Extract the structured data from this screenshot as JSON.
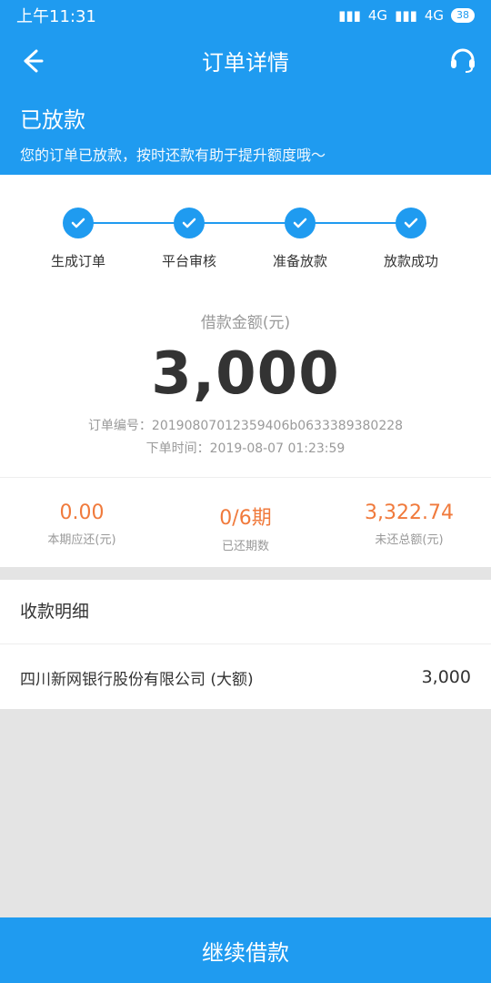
{
  "status": {
    "time": "上午11:31",
    "network_1": "4G",
    "network_2": "4G",
    "battery": "38"
  },
  "navbar": {
    "title": "订单详情"
  },
  "banner": {
    "title": "已放款",
    "subtitle": "您的订单已放款，按时还款有助于提升额度哦～"
  },
  "steps": [
    {
      "label": "生成订单"
    },
    {
      "label": "平台审核"
    },
    {
      "label": "准备放款"
    },
    {
      "label": "放款成功"
    }
  ],
  "loan": {
    "amount_label": "借款金额(元)",
    "amount": "3,000",
    "order_no": "订单编号：2019080701235940​6b0633389380228",
    "order_time": "下单时间：2019-08-07 01:23:59"
  },
  "stats": [
    {
      "value": "0.00",
      "label": "本期应还(元)"
    },
    {
      "value": "0/6期",
      "label": "已还期数"
    },
    {
      "value": "3,322.74",
      "label": "未还总额(元)"
    }
  ],
  "details": {
    "title": "收款明细",
    "bank": "四川新网银行股份有限公司 (大额)",
    "amount": "3,000"
  },
  "cta": {
    "label": "继续借款"
  },
  "colors": {
    "primary": "#1f9bf0",
    "accent": "#f07a3c"
  }
}
